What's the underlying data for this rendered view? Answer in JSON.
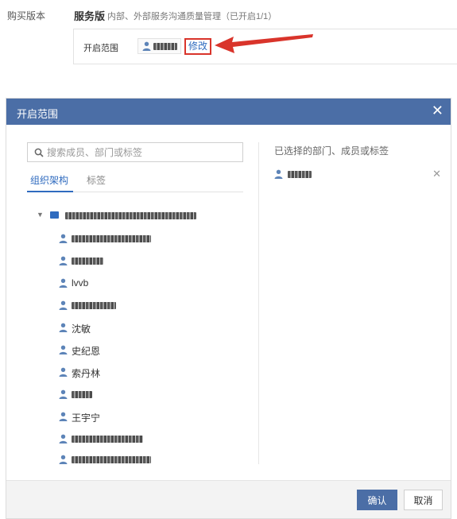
{
  "purchase": {
    "label": "购买版本",
    "version": "服务版",
    "description": "内部、外部服务沟通质量管理（已开启1/1）",
    "scope_label": "开启范围",
    "modify_label": "修改"
  },
  "dialog": {
    "title": "开启范围",
    "close_glyph": "✕",
    "search_placeholder": "搜索成员、部门或标签",
    "tabs": [
      "组织架构",
      "标签"
    ],
    "tree": {
      "members": [
        "lvvb",
        "沈敏",
        "史纪恩",
        "索丹林",
        "王宇宁"
      ]
    },
    "selected_title": "已选择的部门、成员或标签",
    "remove_glyph": "✕",
    "confirm_label": "确认",
    "cancel_label": "取消"
  },
  "colors": {
    "header": "#4b6ea6",
    "link": "#2f6bbf",
    "highlight_border": "#d9342b",
    "arrow": "#d9342b"
  },
  "icons": {
    "person": "person-icon",
    "search": "search-icon",
    "folder": "folder-icon",
    "caret": "caret-down-icon",
    "close": "close-icon",
    "arrow": "arrow-left-icon"
  }
}
